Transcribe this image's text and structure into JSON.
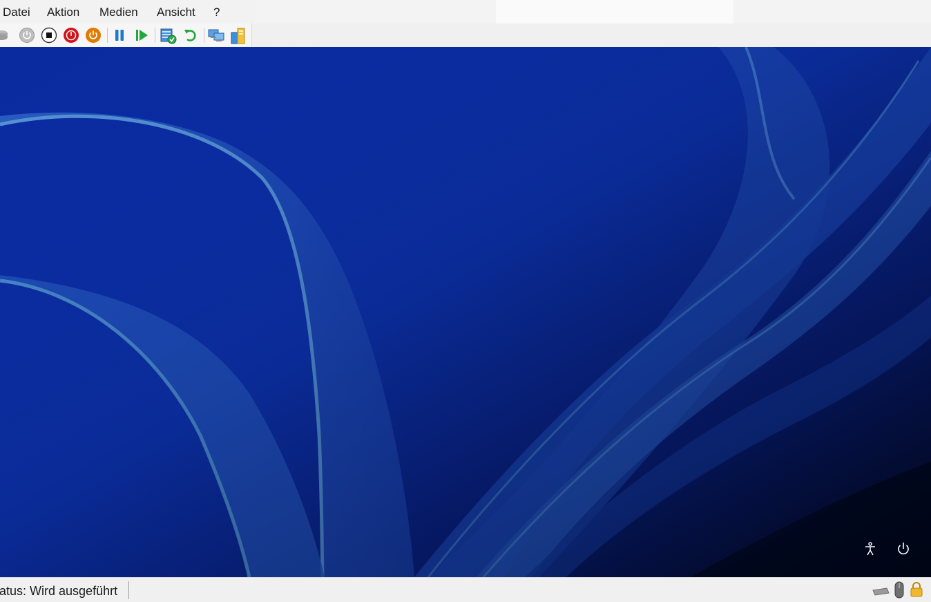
{
  "menu": {
    "items": [
      {
        "label": "Datei"
      },
      {
        "label": "Aktion"
      },
      {
        "label": "Medien"
      },
      {
        "label": "Ansicht"
      },
      {
        "label": "?"
      }
    ]
  },
  "toolbar": {
    "buttons": [
      {
        "icon": "ctrl-alt-del-icon"
      },
      {
        "icon": "start-icon"
      },
      {
        "icon": "turn-off-icon"
      },
      {
        "icon": "shut-down-icon"
      },
      {
        "icon": "save-icon"
      },
      {
        "icon": "pause-icon"
      },
      {
        "icon": "reset-icon"
      },
      {
        "icon": "checkpoint-icon"
      },
      {
        "icon": "revert-icon"
      },
      {
        "icon": "enhanced-session-icon"
      },
      {
        "icon": "share-icon"
      }
    ],
    "colors": {
      "turn_off": "#d0141a",
      "shut_down": "#e07a00",
      "pause": "#1e78d2",
      "play": "#22a83a"
    }
  },
  "vm": {
    "icons": [
      {
        "name": "accessibility-icon"
      },
      {
        "name": "power-icon"
      }
    ],
    "colors": {
      "deep_blue": "#0b2a9a",
      "dark_navy": "#020a2a",
      "ribbon": "#3f78c8"
    }
  },
  "status": {
    "text": "tatus: Wird ausgeführt",
    "icons": [
      "keyboard-icon",
      "mouse-icon",
      "lock-icon"
    ]
  }
}
